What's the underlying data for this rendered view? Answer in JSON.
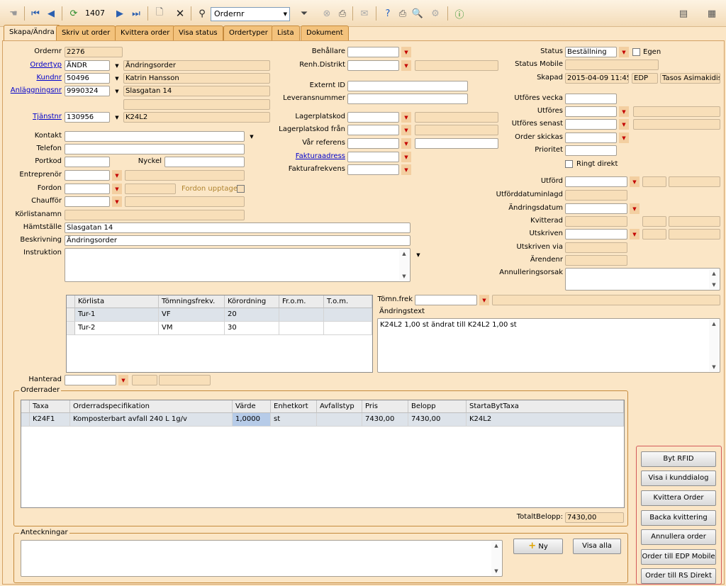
{
  "toolbar": {
    "record_number": "1407",
    "search_field": "Ordernr"
  },
  "tabs": [
    "Skapa/Ändra",
    "Skriv ut order",
    "Kvittera order",
    "Visa status",
    "Ordertyper",
    "Lista",
    "Dokument"
  ],
  "left": {
    "ordernr_label": "Ordernr",
    "ordernr_value": "2276",
    "ordertyp_label": "Ordertyp",
    "ordertyp_code": "ÄNDR",
    "ordertyp_text": "Ändringsorder",
    "kundnr_label": "Kundnr",
    "kundnr_value": "50496",
    "kundnr_name": "Katrin Hansson",
    "anlaggningsnr_label": "Anläggningsnr",
    "anlaggningsnr_value": "9990324",
    "anlaggningsnr_address": "Slasgatan 14",
    "tjanstnr_label": "Tjänstnr",
    "tjanstnr_value": "130956",
    "tjanstnr_text": "K24L2",
    "kontakt_label": "Kontakt",
    "telefon_label": "Telefon",
    "portkod_label": "Portkod",
    "nyckel_label": "Nyckel",
    "entreprenor_label": "Entreprenör",
    "fordon_label": "Fordon",
    "fordon_upptaget_label": "Fordon upptaget",
    "chauffor_label": "Chaufför",
    "korlistanamn_label": "Körlistanamn",
    "hamtstalle_label": "Hämtställe",
    "hamtstalle_value": "Slasgatan 14",
    "beskrivning_label": "Beskrivning",
    "beskrivning_value": "Ändringsorder",
    "instruktion_label": "Instruktion"
  },
  "middle": {
    "behallare_label": "Behållare",
    "renh_distrikt_label": "Renh.Distrikt",
    "externt_id_label": "Externt ID",
    "leveransnummer_label": "Leveransnummer",
    "lagerplatskod_label": "Lagerplatskod",
    "lagerplatskod_fran_label": "Lagerplatskod från",
    "var_referens_label": "Vår referens",
    "fakturaadress_label": "Fakturaadress",
    "fakturafrekvens_label": "Fakturafrekvens"
  },
  "right": {
    "status_label": "Status",
    "status_value": "Beställning",
    "egen_label": "Egen",
    "status_mobile_label": "Status Mobile",
    "skapad_label": "Skapad",
    "skapad_date": "2015-04-09 11:45",
    "skapad_system": "EDP",
    "skapad_user": "Tasos Asimakidis",
    "utfores_vecka_label": "Utföres vecka",
    "utfores_label": "Utföres",
    "utfores_senast_label": "Utföres senast",
    "order_skickas_label": "Order skickas",
    "prioritet_label": "Prioritet",
    "ringt_direkt_label": "Ringt direkt",
    "utford_label": "Utförd",
    "utforddatum_inlagd_label": "Utförddatuminlagd",
    "andringsdatum_label": "Ändringsdatum",
    "kvitterad_label": "Kvitterad",
    "utskriven_label": "Utskriven",
    "utskriven_via_label": "Utskriven via",
    "arendenr_label": "Ärendenr",
    "annulleringsorsak_label": "Annulleringsorsak"
  },
  "korlista_table": {
    "columns": [
      "Körlista",
      "Tömningsfrekv.",
      "Körordning",
      "Fr.o.m.",
      "T.o.m."
    ],
    "rows": [
      [
        "Tur-1",
        "VF",
        "20",
        "",
        ""
      ],
      [
        "Tur-2",
        "VM",
        "30",
        "",
        ""
      ]
    ]
  },
  "tomn": {
    "tomn_frek_label": "Tömn.frek",
    "andringstext_label": "Ändringstext",
    "andringstext_value": "K24L2 1,00 st ändrat till K24L2 1,00 st"
  },
  "hanterad_label": "Hanterad",
  "orderrader": {
    "title": "Orderrader",
    "columns": [
      "Taxa",
      "Orderradspecifikation",
      "Värde",
      "Enhetkort",
      "Avfallstyp",
      "Pris",
      "Belopp",
      "StartaBytTaxa"
    ],
    "rows": [
      [
        "K24F1",
        "Komposterbart avfall 240 L 1g/v",
        "1,0000",
        "st",
        "",
        "7430,00",
        "7430,00",
        "K24L2"
      ]
    ],
    "total_label": "TotaltBelopp:",
    "total_value": "7430,00"
  },
  "anteckningar": {
    "title": "Anteckningar",
    "ny_label": "Ny",
    "visa_alla_label": "Visa alla"
  },
  "actions": [
    "Byt RFID",
    "Visa i kunddialog",
    "Kvittera Order",
    "Backa kvittering",
    "Annullera order",
    "Order till EDP Mobile",
    "Order till RS Direkt"
  ],
  "colors": {
    "accent_red": "#c40000",
    "link": "#0000cc",
    "panel_bg": "#fbe6c6",
    "tab_bg": "#f3c27c"
  }
}
